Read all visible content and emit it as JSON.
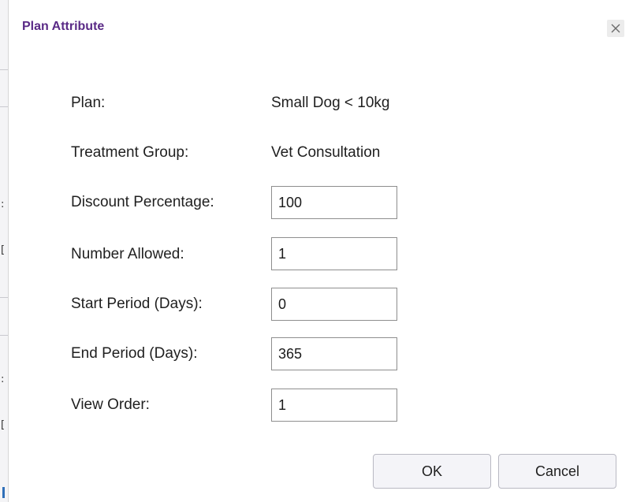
{
  "dialog": {
    "title": "Plan Attribute",
    "close_icon": "close-icon"
  },
  "info": {
    "plan_label": "Plan:",
    "plan_value": "Small Dog < 10kg",
    "group_label": "Treatment Group:",
    "group_value": "Vet Consultation"
  },
  "fields": {
    "discount_label": "Discount Percentage:",
    "discount_value": "100",
    "number_label": "Number Allowed:",
    "number_value": "1",
    "start_label": "Start Period (Days):",
    "start_value": "0",
    "end_label": "End Period (Days):",
    "end_value": "365",
    "order_label": "View Order:",
    "order_value": "1"
  },
  "buttons": {
    "ok": "OK",
    "cancel": "Cancel"
  },
  "background": {
    "marks": [
      ":",
      "[",
      ":",
      "["
    ]
  },
  "colors": {
    "title": "#5a2a86",
    "button_bg": "#f4f4f8",
    "field_border": "#8e8e8e"
  }
}
